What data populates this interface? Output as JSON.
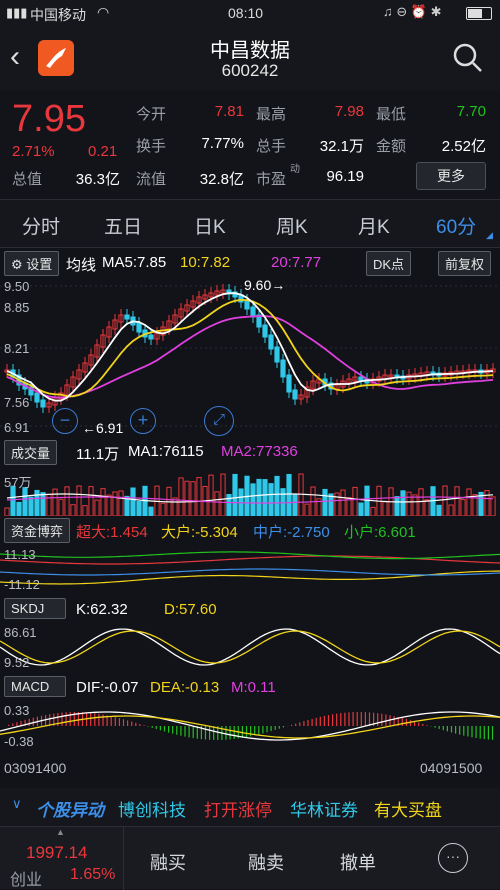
{
  "status_bar": {
    "carrier": "中国移动",
    "time": "08:10",
    "signal_icon": "signal-icon",
    "wifi_icon": "wifi-icon",
    "battery_icon": "battery-icon"
  },
  "header": {
    "title": "中昌数据",
    "code": "600242"
  },
  "quote": {
    "price": "7.95",
    "change_pct": "2.71%",
    "change": "0.21",
    "jinkai_label": "今开",
    "jinkai": "7.81",
    "zuigao_label": "最高",
    "zuigao": "7.98",
    "zuidi_label": "最低",
    "zuidi": "7.70",
    "huanshou_label": "换手",
    "huanshou": "7.77%",
    "zongshou_label": "总手",
    "zongshou": "32.1万",
    "jine_label": "金额",
    "jine": "2.52亿",
    "zongzhi_label": "总值",
    "zongzhi": "36.3亿",
    "liuzhi_label": "流值",
    "liuzhi": "32.8亿",
    "shiying_label": "市盈",
    "shiying_sup": "动",
    "shiying": "96.19",
    "more": "更多"
  },
  "tabs": [
    "分时",
    "五日",
    "日K",
    "周K",
    "月K",
    "60分"
  ],
  "main_chart": {
    "settings": "设置",
    "ma_title": "均线",
    "ma5": "MA5:7.85",
    "ma10": "10:7.82",
    "ma20": "20:7.77",
    "dk": "DK点",
    "fuquan": "前复权",
    "y_labels": [
      "9.50",
      "8.85",
      "8.21",
      "7.56",
      "6.91"
    ],
    "high_mark": "9.60",
    "low_mark": "6.91",
    "colors": {
      "ma5": "#ffffff",
      "ma10": "#f2d41a",
      "ma20": "#e040e0",
      "up": "#e8383d",
      "down": "#30c8e8"
    }
  },
  "volume": {
    "label": "成交量",
    "value": "11.1万",
    "ma1": "MA1:76115",
    "ma2": "MA2:77336",
    "y_label": "57万"
  },
  "fund": {
    "label": "资金博弈",
    "chaoda": "超大:1.454",
    "dahu": "大户:-5.304",
    "zhonghu": "中户:-2.750",
    "xiaohu": "小户:6.601",
    "y_top": "11.13",
    "y_bottom": "-11.12"
  },
  "skdj": {
    "label": "SKDJ",
    "k": "K:62.32",
    "d": "D:57.60",
    "y_top": "86.61",
    "y_bottom": "9.52"
  },
  "macd": {
    "label": "MACD",
    "dif": "DIF:-0.07",
    "dea": "DEA:-0.13",
    "m": "M:0.11",
    "y_top": "0.33",
    "y_bottom": "-0.38"
  },
  "time_axis": {
    "start": "03091400",
    "end": "04091500"
  },
  "news": {
    "title": "个股异动",
    "items": [
      "博创科技",
      "打开涨停",
      "华林证券",
      "有大买盘"
    ]
  },
  "bottom": {
    "index_value": "1997.14",
    "index_name": "创业",
    "index_pct": "1.65%",
    "rongmai": "融买",
    "rongmai2": "融卖",
    "chedan": "撤单"
  }
}
